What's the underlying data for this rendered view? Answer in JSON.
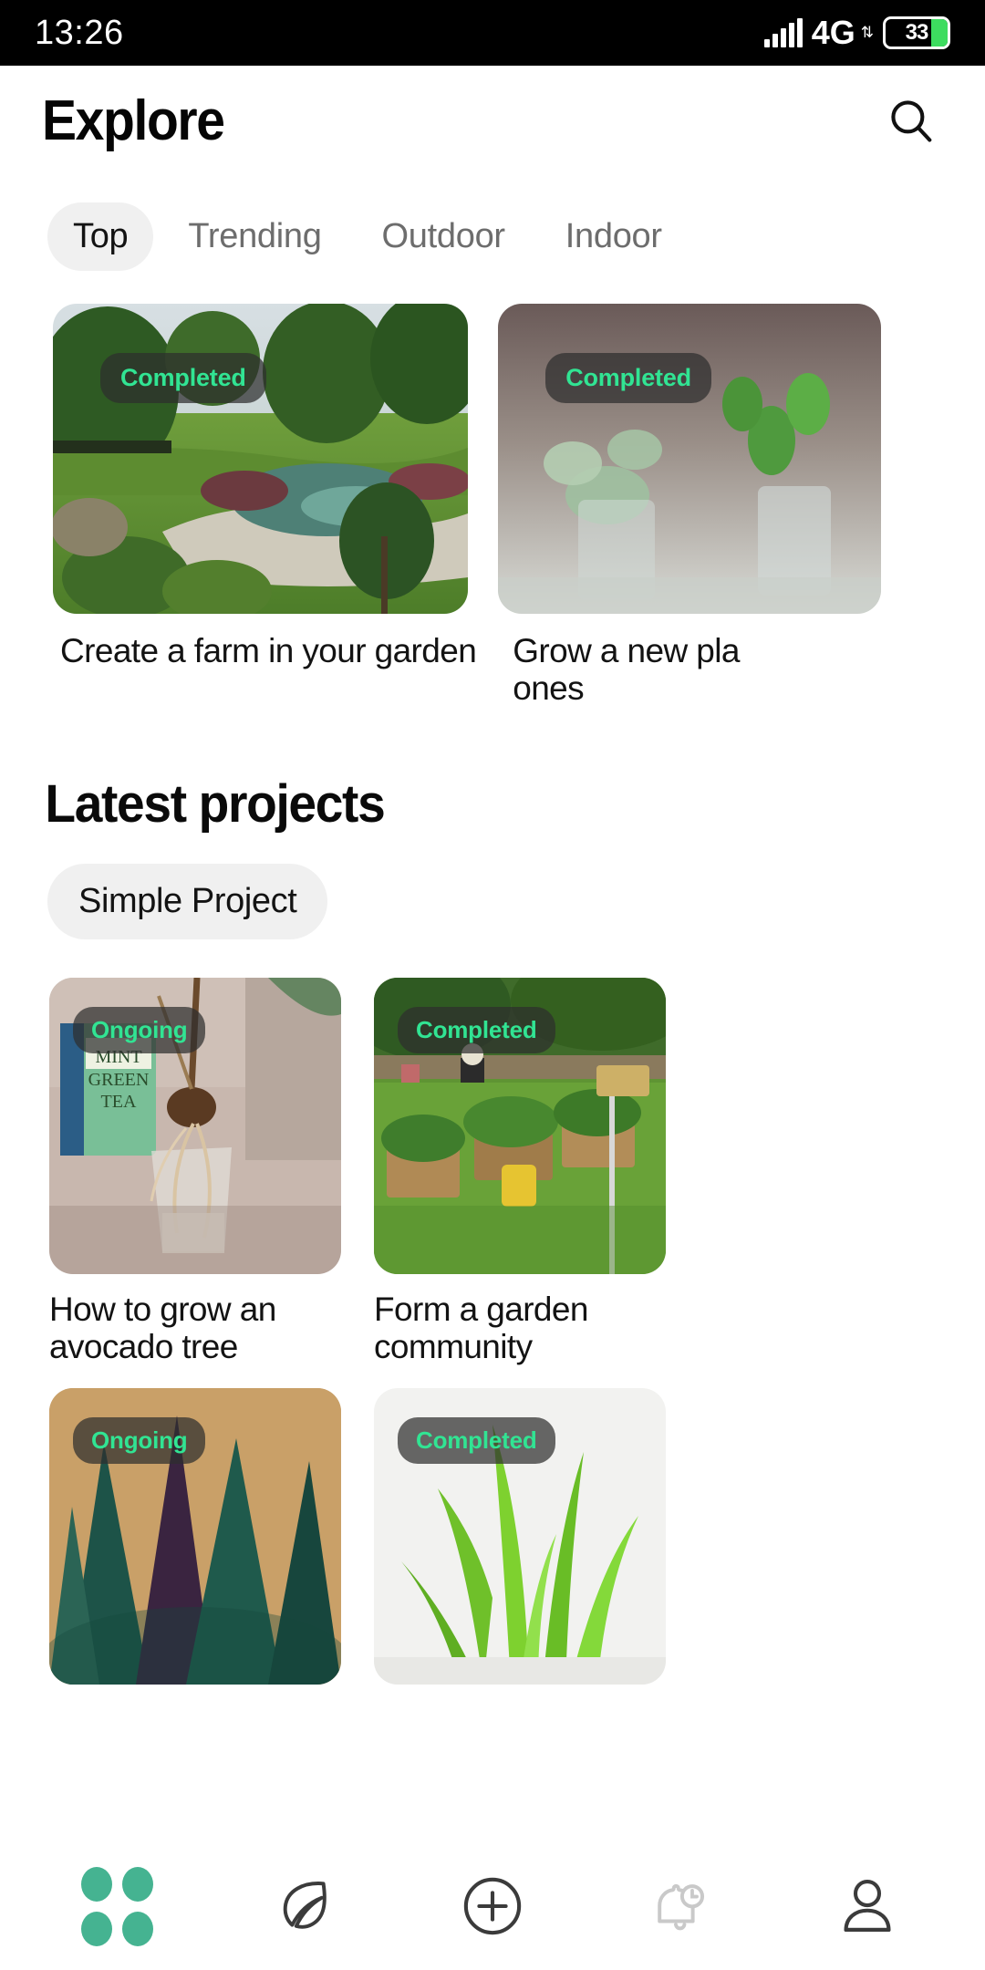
{
  "status_bar": {
    "time": "13:26",
    "network": "4G",
    "network_arrows": "⇅",
    "battery_percent": "33",
    "battery_color": "#3ddc5f",
    "signal_icon": "signal-bars-icon"
  },
  "header": {
    "title": "Explore",
    "search_icon": "search-icon"
  },
  "tabs": [
    {
      "label": "Top",
      "active": true
    },
    {
      "label": "Trending",
      "active": false
    },
    {
      "label": "Outdoor",
      "active": false
    },
    {
      "label": "Indoor",
      "active": false
    }
  ],
  "featured": [
    {
      "badge": "Completed",
      "caption": "Create a farm in your garden",
      "image": "landscaped-garden-with-pond-photo"
    },
    {
      "badge": "Completed",
      "caption": "Grow a new pla\nones",
      "image": "herb-cuttings-in-glass-jars-photo"
    }
  ],
  "latest_section": {
    "title": "Latest projects",
    "chips": [
      {
        "label": "Simple Project",
        "active": true
      }
    ],
    "projects": [
      {
        "badge": "Ongoing",
        "caption": "How to grow an avocado tree",
        "image": "avocado-seed-sprouting-in-cup-photo"
      },
      {
        "badge": "Completed",
        "caption": "Form a garden community",
        "image": "community-raised-beds-garden-photo"
      },
      {
        "badge": "Ongoing",
        "caption": "",
        "image": "dark-green-houseplant-leaves-photo"
      },
      {
        "badge": "Completed",
        "caption": "",
        "image": "birds-nest-fern-photo"
      }
    ]
  },
  "bottom_nav": [
    {
      "name": "explore-grid-icon",
      "active": true
    },
    {
      "name": "leaf-icon",
      "active": false
    },
    {
      "name": "plus-circle-icon",
      "active": false
    },
    {
      "name": "bell-clock-icon",
      "active": false
    },
    {
      "name": "person-icon",
      "active": false
    }
  ],
  "colors": {
    "accent_green": "#31e493",
    "nav_active": "#45b391",
    "chip_bg": "#f0f0f0",
    "badge_bg": "rgba(46,46,46,0.72)"
  }
}
